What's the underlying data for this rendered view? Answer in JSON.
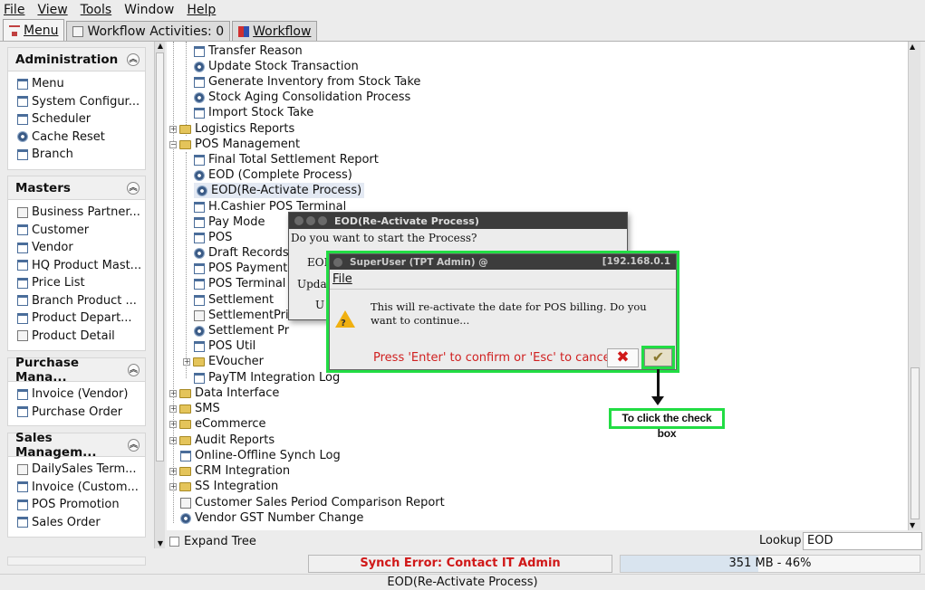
{
  "menubar": {
    "file": "File",
    "view": "View",
    "tools": "Tools",
    "window": "Window",
    "help": "Help"
  },
  "tabs": {
    "menu": "Menu",
    "workflow_activities": "Workflow Activities: 0",
    "workflow": "Workflow"
  },
  "sections": {
    "administration": {
      "title": "Administration",
      "items": [
        "Menu",
        "System Configur...",
        "Scheduler",
        "Cache Reset",
        "Branch"
      ]
    },
    "masters": {
      "title": "Masters",
      "items": [
        "Business Partner...",
        "Customer",
        "Vendor",
        "HQ Product Mast...",
        "Price List",
        "Branch Product ...",
        "Product Depart...",
        "Product Detail"
      ]
    },
    "purchase": {
      "title": "Purchase Mana...",
      "items": [
        "Invoice (Vendor)",
        "Purchase Order"
      ]
    },
    "sales": {
      "title": "Sales Managem...",
      "items": [
        "DailySales Term...",
        "Invoice (Custom...",
        "POS Promotion",
        "Sales Order"
      ]
    }
  },
  "tree": [
    "Transfer Reason",
    "Update Stock Transaction",
    "Generate Inventory from Stock Take",
    "Stock Aging Consolidation Process",
    "Import Stock Take",
    "Logistics Reports",
    "POS Management",
    "Final Total Settlement Report",
    "EOD (Complete Process)",
    "EOD(Re-Activate Process)",
    "H.Cashier POS Terminal",
    "Pay Mode",
    "POS",
    "Draft Records",
    "POS Payment",
    "POS Terminal",
    "Settlement",
    "SettlementPri",
    "Settlement Pr",
    "POS Util",
    "EVoucher",
    "PayTM Integration Log",
    "Data Interface",
    "SMS",
    "eCommerce",
    "Audit Reports",
    "Online-Offline Synch Log",
    "CRM Integration",
    "SS Integration",
    "Customer Sales Period Comparison Report",
    "Vendor GST Number Change"
  ],
  "bottom": {
    "expand_tree": "Expand Tree",
    "lookup_label": "Lookup",
    "lookup_value": "EOD"
  },
  "status": {
    "synch_error": "Synch Error: Contact IT Admin",
    "memory": "351 MB - 46%",
    "memory_fraction": 0.46,
    "footer": "EOD(Re-Activate Process)"
  },
  "dialog1": {
    "title": "EOD(Re-Activate Process)",
    "question": "Do you want to start the Process?",
    "row1": "EOI",
    "row2": "Upda",
    "row3": "U"
  },
  "dialog2": {
    "title": "SuperUser (TPT Admin) @",
    "ip": "[192.168.0.1",
    "menu_file": "File",
    "message": "This will re-activate the date for POS billing. Do you want to continue...",
    "hint": "Press 'Enter' to confirm or 'Esc' to cancel",
    "cancel_symbol": "✖",
    "ok_symbol": "✔"
  },
  "annotation": {
    "text": "To click the check box"
  },
  "colors": {
    "highlight": "#22dd44",
    "error": "#d01818"
  }
}
